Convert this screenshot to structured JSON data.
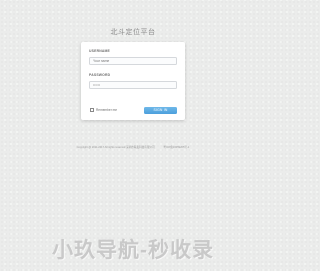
{
  "page": {
    "title": "北斗定位平台"
  },
  "login": {
    "username_label": "USERNAME",
    "username_placeholder": "Your name",
    "password_label": "PASSWORD",
    "password_value": "••••••",
    "remember_label": "Remember me",
    "signin_label": "SIGN IN"
  },
  "footer": {
    "copyright": "Copyright @ 2011-2017 All rights reserved 深圳市联发科技有限公司",
    "icp": "粤ICP备16059205号-1"
  },
  "watermark": {
    "text": "小玖导航-秒收录"
  },
  "colors": {
    "background": "#ebeceb",
    "card": "#ffffff",
    "button": "#56a6df"
  }
}
